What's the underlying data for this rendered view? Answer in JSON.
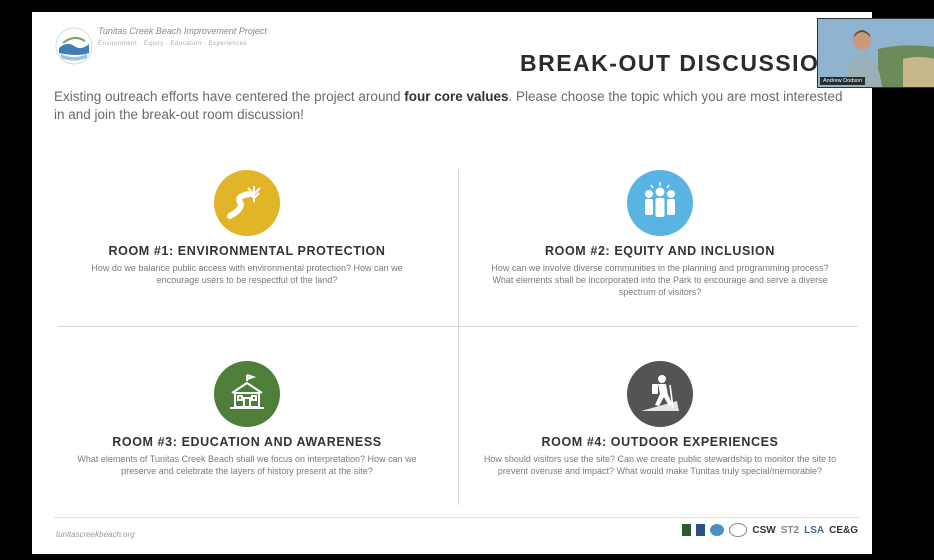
{
  "project": {
    "title": "Tunitas Creek Beach Improvement Project",
    "subtitle": "Environment  ·  Equity  ·  Education  ·  Experiences"
  },
  "slide": {
    "title": "BREAK-OUT DISCUSSIO",
    "intro_before": "Existing outreach efforts have centered the project around ",
    "intro_bold": "four core values",
    "intro_after": ". Please choose the topic which you are most interested in and join the break-out room discussion!"
  },
  "rooms": [
    {
      "title": "ROOM #1: ENVIRONMENTAL PROTECTION",
      "text": "How do we balance public access with environmental protection? How can we encourage users to be respectful of the land?"
    },
    {
      "title": "ROOM #2: EQUITY AND INCLUSION",
      "text": "How can we involve diverse communities in the planning and programming process? What elements shall be incorporated into the Park to encourage and serve a diverse spectrum of visitors?"
    },
    {
      "title": "ROOM #3: EDUCATION AND AWARENESS",
      "text": "What elements of Tunitas Creek Beach shall we focus on interpretation? How can we preserve and celebrate the layers of history present at the site?"
    },
    {
      "title": "ROOM #4: OUTDOOR EXPERIENCES",
      "text": "How should visitors use the site? Can we create public stewardship to monitor the site to prevent overuse and impact? What would make Tunitas truly special/memorable?"
    }
  ],
  "colors": {
    "room1": "#e2b427",
    "room2": "#5ab4e3",
    "room3": "#4f7e3a",
    "room4": "#545454"
  },
  "footer": {
    "url": "tunitascreekbeach.org",
    "partners": [
      "CSW",
      "ST2",
      "LSA",
      "CE&G"
    ]
  },
  "video": {
    "participant_name": "Andrew Dodson"
  }
}
